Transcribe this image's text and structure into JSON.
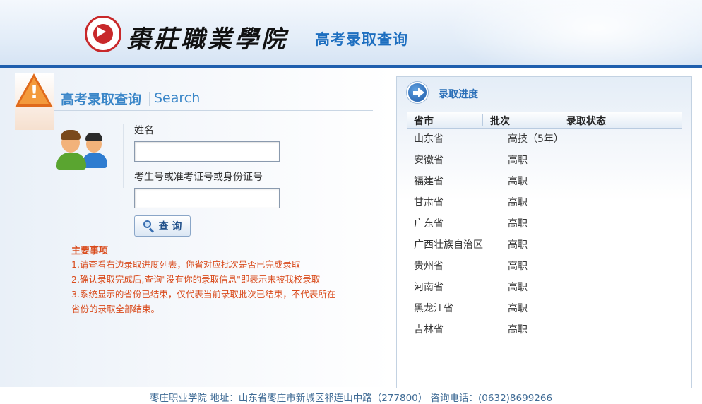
{
  "header": {
    "college_name": "棗莊職業學院",
    "title": "高考录取查询"
  },
  "search_panel": {
    "heading": "高考录取查询",
    "heading_en": "Search",
    "name_label": "姓名",
    "name_value": "",
    "id_label": "考生号或准考证号或身份证号",
    "id_value": "",
    "query_button": "查 询",
    "notes_title": "主要事项",
    "notes": [
      "1.请查看右边录取进度列表，你省对应批次是否已完成录取",
      "2.确认录取完成后,查询\"没有你的录取信息\"即表示未被我校录取",
      "3.系统显示的省份已结束，仅代表当前录取批次已结束，不代表所在",
      "省份的录取全部结束。"
    ]
  },
  "progress_panel": {
    "title": "录取进度",
    "columns": [
      "省市",
      "批次",
      "录取状态"
    ],
    "rows": [
      {
        "province": "山东省",
        "batch": "高技（5年）",
        "status": ""
      },
      {
        "province": "安徽省",
        "batch": "高职",
        "status": ""
      },
      {
        "province": "福建省",
        "batch": "高职",
        "status": ""
      },
      {
        "province": "甘肃省",
        "batch": "高职",
        "status": ""
      },
      {
        "province": "广东省",
        "batch": "高职",
        "status": ""
      },
      {
        "province": "广西壮族自治区",
        "batch": "高职",
        "status": ""
      },
      {
        "province": "贵州省",
        "batch": "高职",
        "status": ""
      },
      {
        "province": "河南省",
        "batch": "高职",
        "status": ""
      },
      {
        "province": "黑龙江省",
        "batch": "高职",
        "status": ""
      },
      {
        "province": "吉林省",
        "batch": "高职",
        "status": ""
      }
    ]
  },
  "footer": {
    "text": "枣庄职业学院    地址：山东省枣庄市新城区祁连山中路（277800）  咨询电话：(0632)8699266"
  },
  "colors": {
    "accent_blue": "#1f5fae",
    "heading_blue": "#3a86c8",
    "notes_orange": "#d94b1c"
  }
}
